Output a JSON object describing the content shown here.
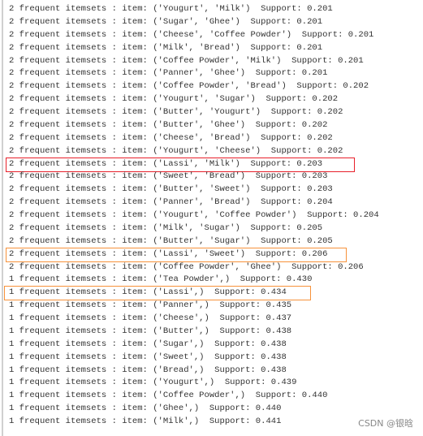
{
  "console": {
    "lines": [
      {
        "text": "2 frequent itemsets : item: ('Yougurt', 'Milk')  Support: 0.201"
      },
      {
        "text": "2 frequent itemsets : item: ('Sugar', 'Ghee')  Support: 0.201"
      },
      {
        "text": "2 frequent itemsets : item: ('Cheese', 'Coffee Powder')  Support: 0.201"
      },
      {
        "text": "2 frequent itemsets : item: ('Milk', 'Bread')  Support: 0.201"
      },
      {
        "text": "2 frequent itemsets : item: ('Coffee Powder', 'Milk')  Support: 0.201"
      },
      {
        "text": "2 frequent itemsets : item: ('Panner', 'Ghee')  Support: 0.201"
      },
      {
        "text": "2 frequent itemsets : item: ('Coffee Powder', 'Bread')  Support: 0.202"
      },
      {
        "text": "2 frequent itemsets : item: ('Yougurt', 'Sugar')  Support: 0.202"
      },
      {
        "text": "2 frequent itemsets : item: ('Butter', 'Yougurt')  Support: 0.202"
      },
      {
        "text": "2 frequent itemsets : item: ('Butter', 'Ghee')  Support: 0.202"
      },
      {
        "text": "2 frequent itemsets : item: ('Cheese', 'Bread')  Support: 0.202"
      },
      {
        "text": "2 frequent itemsets : item: ('Yougurt', 'Cheese')  Support: 0.202"
      },
      {
        "text": "2 frequent itemsets : item: ('Lassi', 'Milk')  Support: 0.203",
        "highlight": "red"
      },
      {
        "text": "2 frequent itemsets : item: ('Sweet', 'Bread')  Support: 0.203"
      },
      {
        "text": "2 frequent itemsets : item: ('Butter', 'Sweet')  Support: 0.203"
      },
      {
        "text": "2 frequent itemsets : item: ('Panner', 'Bread')  Support: 0.204"
      },
      {
        "text": "2 frequent itemsets : item: ('Yougurt', 'Coffee Powder')  Support: 0.204"
      },
      {
        "text": "2 frequent itemsets : item: ('Milk', 'Sugar')  Support: 0.205"
      },
      {
        "text": "2 frequent itemsets : item: ('Butter', 'Sugar')  Support: 0.205"
      },
      {
        "text": "2 frequent itemsets : item: ('Lassi', 'Sweet')  Support: 0.206",
        "highlight": "orange"
      },
      {
        "text": "2 frequent itemsets : item: ('Coffee Powder', 'Ghee')  Support: 0.206"
      },
      {
        "text": "1 frequent itemsets : item: ('Tea Powder',)  Support: 0.430"
      },
      {
        "text": "1 frequent itemsets : item: ('Lassi',)  Support: 0.434",
        "highlight": "orange"
      },
      {
        "text": "1 frequent itemsets : item: ('Panner',)  Support: 0.435"
      },
      {
        "text": "1 frequent itemsets : item: ('Cheese',)  Support: 0.437"
      },
      {
        "text": "1 frequent itemsets : item: ('Butter',)  Support: 0.438"
      },
      {
        "text": "1 frequent itemsets : item: ('Sugar',)  Support: 0.438"
      },
      {
        "text": "1 frequent itemsets : item: ('Sweet',)  Support: 0.438"
      },
      {
        "text": "1 frequent itemsets : item: ('Bread',)  Support: 0.438"
      },
      {
        "text": "1 frequent itemsets : item: ('Yougurt',)  Support: 0.439"
      },
      {
        "text": "1 frequent itemsets : item: ('Coffee Powder',)  Support: 0.440"
      },
      {
        "text": "1 frequent itemsets : item: ('Ghee',)  Support: 0.440"
      },
      {
        "text": "1 frequent itemsets : item: ('Milk',)  Support: 0.441"
      }
    ]
  },
  "watermark": "CSDN @银晗",
  "colors": {
    "highlight_red": "#e8202a",
    "highlight_orange": "#f7923a"
  }
}
